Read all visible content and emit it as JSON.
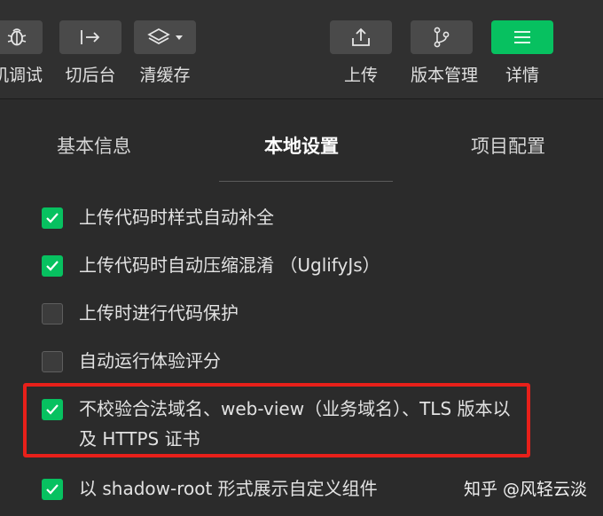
{
  "toolbar": {
    "left_buttons": [
      {
        "label": "机调试",
        "icon": "bug-icon"
      },
      {
        "label": "切后台",
        "icon": "switch-background-icon"
      },
      {
        "label": "清缓存",
        "icon": "layers-icon"
      }
    ],
    "right_buttons": [
      {
        "label": "上传",
        "icon": "upload-icon"
      },
      {
        "label": "版本管理",
        "icon": "branch-icon"
      },
      {
        "label": "详情",
        "icon": "menu-icon"
      }
    ]
  },
  "tabs": [
    {
      "label": "基本信息"
    },
    {
      "label": "本地设置",
      "active": true
    },
    {
      "label": "项目配置"
    }
  ],
  "options": [
    {
      "label": "上传代码时样式自动补全",
      "checked": true
    },
    {
      "label": "上传代码时自动压缩混淆 （UglifyJs）",
      "checked": true
    },
    {
      "label": "上传时进行代码保护",
      "checked": false
    },
    {
      "label": "自动运行体验评分",
      "checked": false
    },
    {
      "label": "不校验合法域名、web-view（业务域名）、TLS 版本以及 HTTPS 证书",
      "checked": true
    },
    {
      "label": "以 shadow-root 形式展示自定义组件",
      "checked": true
    }
  ],
  "watermark": "知乎 @风轻云淡",
  "colors": {
    "accent": "#07c160",
    "highlight": "#e8201a",
    "background": "#2b2b2b"
  }
}
